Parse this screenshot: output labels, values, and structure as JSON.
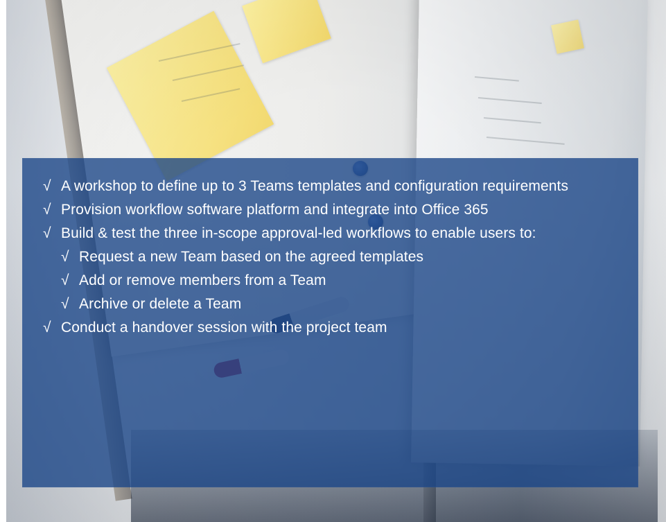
{
  "overlay": {
    "items": [
      {
        "check": "√",
        "text": "A workshop to define up to 3 Teams templates and configuration requirements"
      },
      {
        "check": "√",
        "text": "Provision workflow software platform and integrate into Office 365"
      },
      {
        "check": "√",
        "text": "Build & test the three in-scope approval-led workflows to enable users to:"
      },
      {
        "check": "√",
        "text": "Request a new Team based on the agreed templates"
      },
      {
        "check": "√",
        "text": "Add or remove members from a Team"
      },
      {
        "check": "√",
        "text": "Archive or delete a Team"
      },
      {
        "check": "√",
        "text": "Conduct a handover session with the project team"
      }
    ]
  }
}
